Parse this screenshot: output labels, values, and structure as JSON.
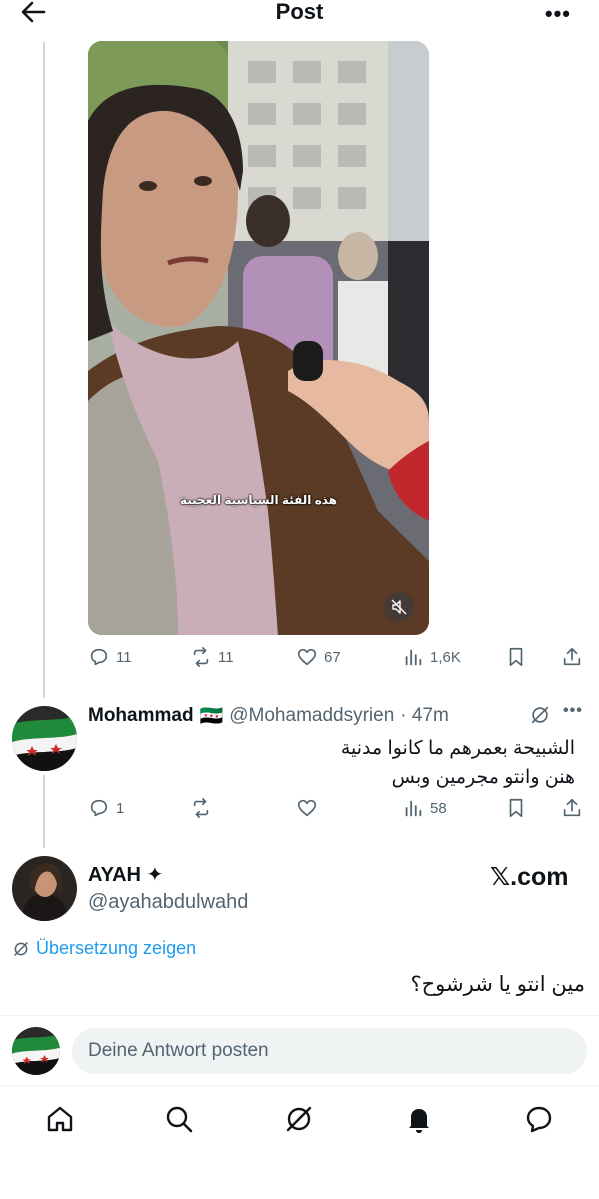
{
  "header": {
    "title": "Post",
    "back_icon": "arrow-left-icon",
    "more_icon": "more-icon",
    "more_label": "•••"
  },
  "post": {
    "caption": "هذه الفئة السياسية العجيبة",
    "muted": true,
    "stats": {
      "replies": "11",
      "reposts": "11",
      "likes": "67",
      "views": "1,6K"
    }
  },
  "reply": {
    "name": "Mohammad",
    "flag": "🇸🇾",
    "handle": "@Mohamaddsyrien",
    "time": "· 47m",
    "more_label": "•••",
    "text_lines": [
      "الشبيحة بعمرهم ما كانوا مدنية",
      "هنن وانتو مجرمين وبس"
    ],
    "stats": {
      "replies": "1",
      "views": "58"
    }
  },
  "quoted": {
    "name": "AYAH ✦",
    "handle": "@ayahabdulwahd",
    "source": "𝕏.com",
    "translate_label": "Übersetzung zeigen",
    "text": "مين انتو يا شرشوح؟"
  },
  "composer": {
    "placeholder": "Deine Antwort posten"
  },
  "nav": {
    "items": [
      "home-icon",
      "search-icon",
      "grok-icon",
      "notifications-icon",
      "messages-icon"
    ]
  },
  "colors": {
    "text": "#0f1419",
    "secondary": "#536471",
    "link": "#1d9bf0",
    "line": "#cfd9de"
  }
}
